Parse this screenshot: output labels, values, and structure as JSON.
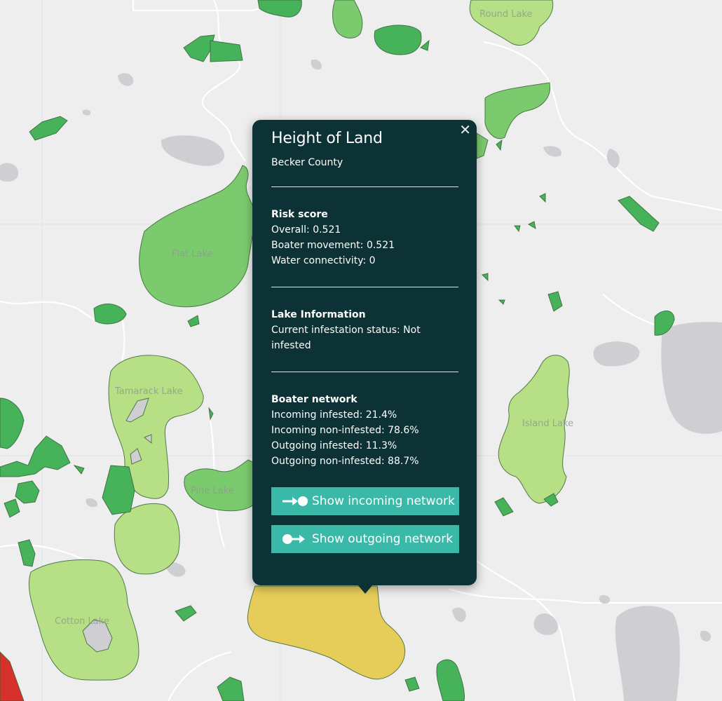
{
  "map": {
    "labels": [
      "Round Lake",
      "Flat Lake",
      "Tamarack Lake",
      "Pine Lake",
      "Island Lake",
      "Cotton Lake"
    ],
    "colors": {
      "background": "#eeeeef",
      "water": "#cfcfd3",
      "road": "#ffffff",
      "risk_dark_green": "#46b25a",
      "risk_green": "#7cca6e",
      "risk_light_green": "#b7df86",
      "risk_yellow": "#e6cd5a",
      "risk_red": "#d8312c"
    }
  },
  "popup": {
    "title": "Height of Land",
    "county": "Becker County",
    "close_glyph": "✕",
    "risk": {
      "heading": "Risk score",
      "overall": "Overall: 0.521",
      "boater_movement": "Boater movement: 0.521",
      "water_connectivity": "Water connectivity: 0"
    },
    "lake_info": {
      "heading": "Lake Information",
      "status": "Current infestation status: Not infested"
    },
    "network": {
      "heading": "Boater network",
      "incoming_infested": "Incoming infested: 21.4%",
      "incoming_non_infested": "Incoming non-infested: 78.6%",
      "outgoing_infested": "Outgoing infested: 11.3%",
      "outgoing_non_infested": "Outgoing non-infested: 88.7%"
    },
    "buttons": {
      "incoming": "Show incoming network",
      "outgoing": "Show outgoing network"
    },
    "colors": {
      "panel": "#0c3235",
      "button": "#3bb9a8"
    }
  }
}
